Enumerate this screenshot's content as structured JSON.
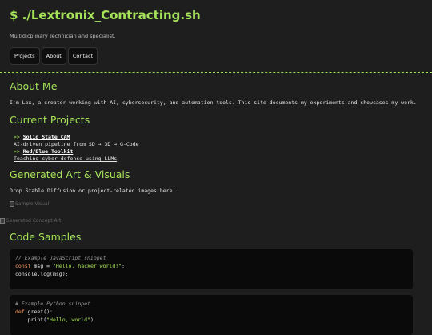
{
  "header": {
    "title": "$ ./Lextronix_Contracting.sh",
    "tagline": "Multidicplinary Technician and specialist."
  },
  "nav": {
    "projects": "Projects",
    "about": "About",
    "contact": "Contact"
  },
  "about": {
    "heading": "About Me",
    "text": "I'm Lex, a creator working with AI, cybersecurity, and automation tools. This site documents my experiments and showcases my work."
  },
  "projects": {
    "heading": "Current Projects",
    "items": [
      {
        "arrow": ">>",
        "title": "Solid State CAM",
        "desc": "AI-driven pipeline from SD → 3D → G-Code"
      },
      {
        "arrow": ">>",
        "title": "Red/Blue Toolkit",
        "desc": "Teaching cyber defense using LLMs"
      }
    ]
  },
  "art": {
    "heading": "Generated Art & Visuals",
    "text": "Drop Stable Diffusion or project-related images here:",
    "image1_alt": "Sample Visual",
    "image2_alt": "Generated Concept Art"
  },
  "code": {
    "heading": "Code Samples",
    "js": {
      "comment": "// Example JavaScript snippet",
      "l2_kw": "const",
      "l2_mid": " msg = ",
      "l2_str": "\"Hello, hacker world!\"",
      "l2_end": ";",
      "l3": "console.log(msg);"
    },
    "py": {
      "comment": "# Example Python snippet",
      "l2_kw": "def",
      "l2_rest": " greet():",
      "l3_pre": "    print(",
      "l3_str": "\"Hello, world\"",
      "l3_end": ")"
    }
  },
  "colors": {
    "accent": "#a6e35a",
    "background": "#1e1e1e",
    "keyword": "#ff9b61"
  }
}
